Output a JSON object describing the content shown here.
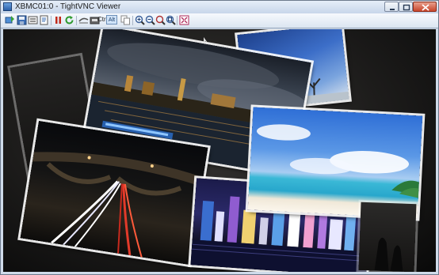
{
  "window": {
    "title": "XBMC01:0 - TightVNC Viewer",
    "app_icon": "vnc-app-icon"
  },
  "toolbar": {
    "ctrl_label": "Ctrl",
    "alt_label": "Alt",
    "icons": [
      "new-connection-icon",
      "save-icon",
      "options-icon",
      "info-icon",
      "pause-icon",
      "refresh-icon",
      "transfer-icon",
      "send-ctrl-alt-del-icon",
      "copy-clipboard-icon",
      "zoom-in-icon",
      "zoom-out-icon",
      "zoom-100-icon",
      "zoom-fit-icon",
      "fullscreen-icon"
    ]
  },
  "viewer": {
    "content": "xbmc-picture-slideshow",
    "photos": [
      "london-night-skyline",
      "evening-tree-landscape",
      "beach-lagoon",
      "bridge-light-trails",
      "city-night-skyline"
    ]
  },
  "colors": {
    "titlebar": "#c7d6ea",
    "toolbar": "#dbe5f1",
    "viewport_bg": "#1b1a19",
    "close_button": "#c8452b"
  }
}
